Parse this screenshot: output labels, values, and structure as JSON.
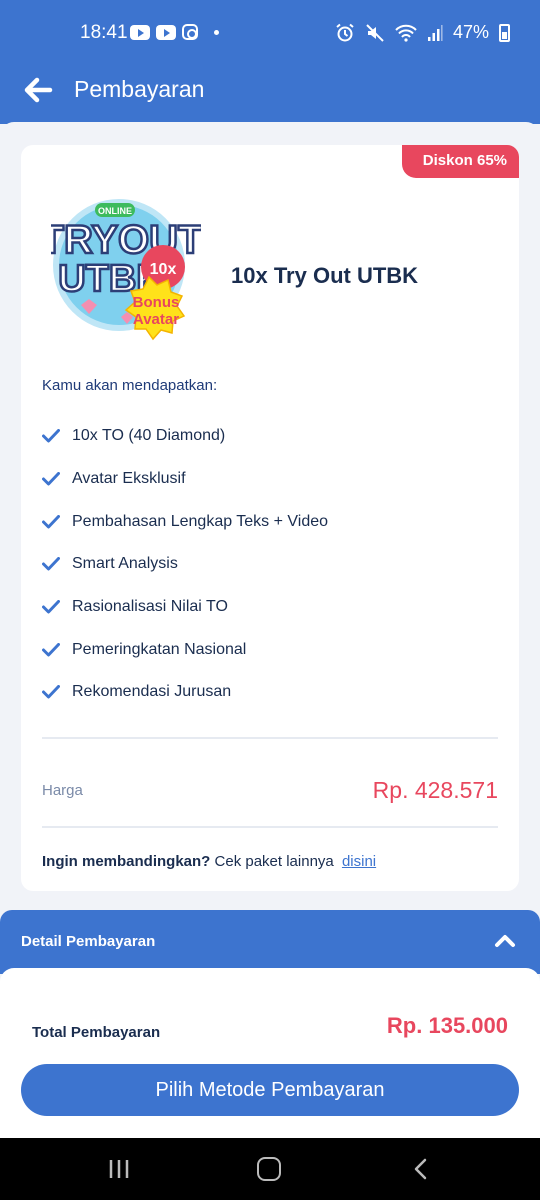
{
  "status_bar": {
    "time": "18:41",
    "app_icons": [
      "youtube-icon",
      "youtube-icon",
      "instagram-icon"
    ],
    "battery": "47%"
  },
  "header": {
    "title": "Pembayaran",
    "back_icon": "arrow-left-icon"
  },
  "package": {
    "discount_badge": "Diskon 65%",
    "logo_text": {
      "badge": "ONLINE",
      "line1": "TRYOUT",
      "line2": "UTBK",
      "count": "10x",
      "bonus1": "Bonus",
      "bonus2": "Avatar"
    },
    "name": "10x Try Out UTBK",
    "benefits_title": "Kamu akan mendapatkan:",
    "benefits": [
      "10x TO (40 Diamond)",
      "Avatar Eksklusif",
      "Pembahasan Lengkap Teks + Video",
      "Smart Analysis",
      "Rasionalisasi Nilai TO",
      "Pemeringkatan Nasional",
      "Rekomendasi Jurusan"
    ],
    "price_label": "Harga",
    "price": "Rp. 428.571",
    "compare_question": "Ingin membandingkan?",
    "compare_text": "Cek paket lainnya",
    "compare_link": "disini"
  },
  "payment": {
    "detail_label": "Detail Pembayaran",
    "total_label": "Total Pembayaran",
    "total": "Rp. 135.000",
    "button_label": "Pilih Metode Pembayaran"
  },
  "colors": {
    "primary": "#3d74cf",
    "accent": "#e8475e",
    "text": "#1a2d4f"
  }
}
